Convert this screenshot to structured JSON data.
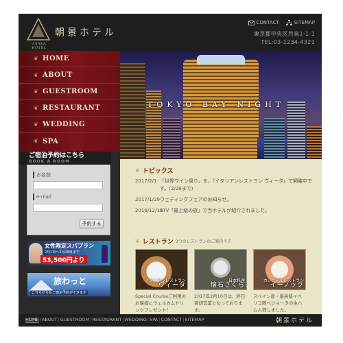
{
  "header": {
    "logo_text": "朝景ホテル",
    "logo_sub": "ASAKA HOTEL",
    "contact_label": "CONTACT",
    "sitemap_label": "SITEMAP",
    "address": "東京都中央区月島1-1-1",
    "tel": "TEL:03-1234-4321"
  },
  "nav": {
    "items": [
      {
        "label": "HOME"
      },
      {
        "label": "ABOUT"
      },
      {
        "label": "GUESTROOM"
      },
      {
        "label": "RESTAURANT"
      },
      {
        "label": "WEDDING"
      },
      {
        "label": "SPA"
      }
    ]
  },
  "booking": {
    "title": "ご宿泊予約はこちら",
    "subtitle": "BOOK A ROOM",
    "name_label": "お名前",
    "email_label": "e-mail",
    "submit_label": "予約する"
  },
  "banners": {
    "spa": {
      "title": "女性限定スパプラン",
      "period": "2月1日～2月28日まで",
      "price": "53,500円より"
    },
    "tabiwatto": {
      "title": "旅わっと",
      "text": "こちらからもご宿泊予約ができます"
    }
  },
  "hero": {
    "caption": "TOKYO BAY NIGHT"
  },
  "topics": {
    "heading": "トピックス",
    "items": [
      {
        "date": "2017/2/1",
        "text": "「世界ワイン祭り」を、『イタリアンレストラン ヴィータ』で開催中です。(2/28まで)"
      },
      {
        "date": "2017/1/29",
        "text": "ウェディングフェアのお知らせ。"
      },
      {
        "date": "2016/12/15",
        "text": "ATV「最上級の旅」で当ホテルが紹介されました。"
      }
    ]
  },
  "restaurant": {
    "heading": "レストラン",
    "subheading": "3つのレストランのご案内です",
    "cards": [
      {
        "cap_small": "イタリアンレストラン",
        "cap_big": "ヴィータ",
        "desc": "Special Courseご利用のお客様にウェルカムドリンクプレゼント！"
      },
      {
        "cap_small": "日本料理",
        "cap_big": "懐石さくら",
        "desc": "2017年2月10日は、終日貸切営業となっております。"
      },
      {
        "cap_small": "カジュアルレストラン",
        "cap_big": "イーノック",
        "desc": "スペイン産・最高級イベリコ豚ベジョータの生ハム入荷しました。"
      }
    ]
  },
  "footer": {
    "links": [
      "HOME",
      "ABOUT",
      "GUESTROOM",
      "RESTAURANT",
      "WEDDING",
      "SPA",
      "CONTACT",
      "SITEMAP"
    ],
    "logo": "朝景ホテル"
  },
  "colors": {
    "nav_bg": "#6a1015",
    "content_bg": "#e9e5c8",
    "heading": "#7a3410",
    "dark": "#1e1e1e"
  }
}
